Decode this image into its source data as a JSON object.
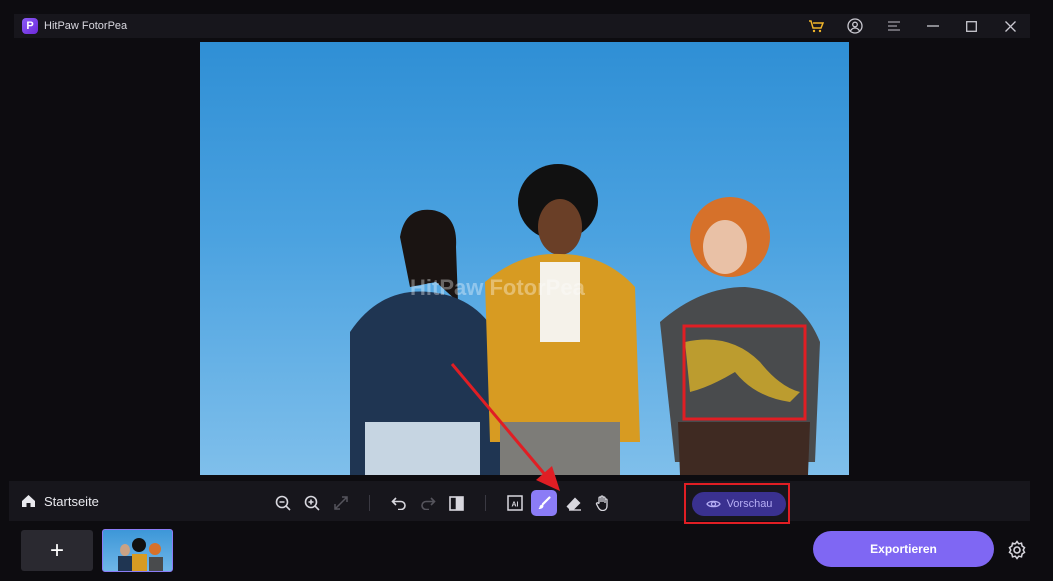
{
  "titlebar": {
    "logo_letter": "P",
    "app_title": "HitPaw FotorPea",
    "icons": [
      "cart-icon",
      "account-icon",
      "menu-icon",
      "minimize-icon",
      "maximize-icon",
      "close-icon"
    ]
  },
  "canvas": {
    "watermark": "HitPaw FotorPea"
  },
  "bottom": {
    "home_label": "Startseite",
    "tools": [
      "zoom-out-icon",
      "zoom-in-icon",
      "fit-icon",
      "undo-icon",
      "redo-icon",
      "compare-icon",
      "ai-select-icon",
      "brush-icon",
      "eraser-icon",
      "hand-icon"
    ],
    "preview_label": "Vorschau",
    "add_label": "+",
    "export_label": "Exportieren"
  },
  "colors": {
    "accent": "#7f67f3",
    "highlight": "#e01e24",
    "panel": "#17161c"
  }
}
